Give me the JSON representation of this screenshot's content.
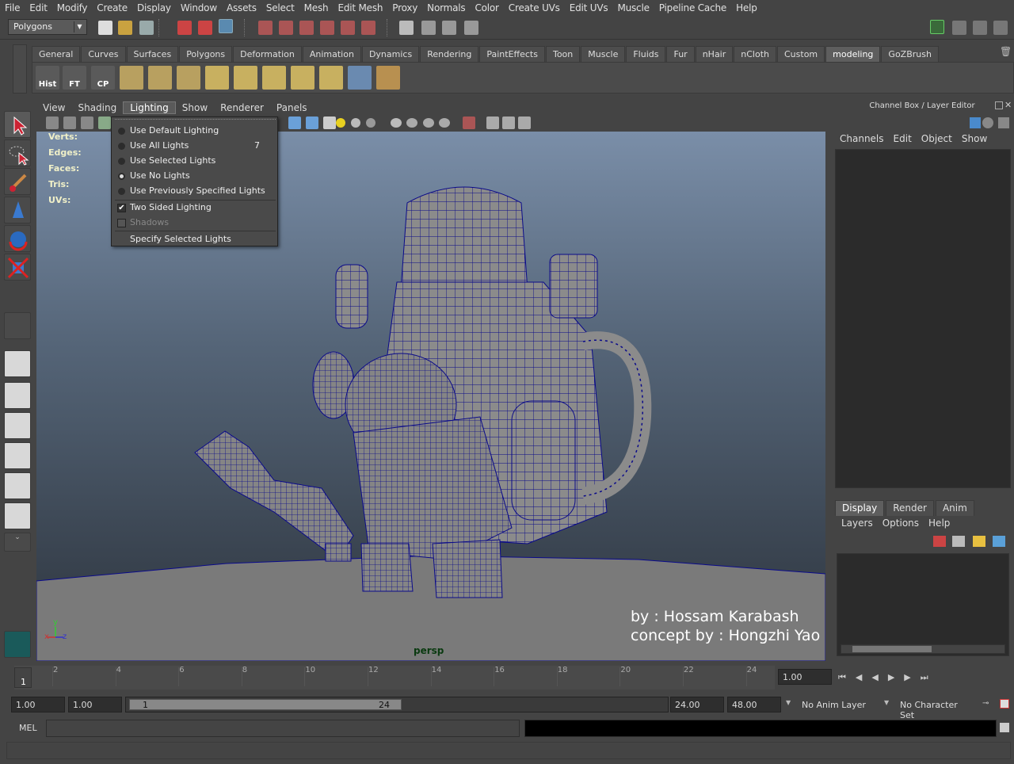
{
  "menubar": [
    "File",
    "Edit",
    "Modify",
    "Create",
    "Display",
    "Window",
    "Assets",
    "Select",
    "Mesh",
    "Edit Mesh",
    "Proxy",
    "Normals",
    "Color",
    "Create UVs",
    "Edit UVs",
    "Muscle",
    "Pipeline Cache",
    "Help"
  ],
  "status": {
    "mode": "Polygons"
  },
  "shelf": {
    "tabs": [
      "General",
      "Curves",
      "Surfaces",
      "Polygons",
      "Deformation",
      "Animation",
      "Dynamics",
      "Rendering",
      "PaintEffects",
      "Toon",
      "Muscle",
      "Fluids",
      "Fur",
      "nHair",
      "nCloth",
      "Custom",
      "modeling",
      "GoZBrush"
    ],
    "active_tab": "modeling",
    "buttons": [
      "Hist",
      "FT",
      "CP"
    ]
  },
  "panel": {
    "menu": [
      "View",
      "Shading",
      "Lighting",
      "Show",
      "Renderer",
      "Panels"
    ],
    "active_menu": "Lighting",
    "hud_labels": [
      "Verts:",
      "Edges:",
      "Faces:",
      "Tris:",
      "UVs:"
    ],
    "camera": "persp",
    "credit_line1": "by : Hossam Karabash",
    "credit_line2": "concept by : Hongzhi Yao",
    "axis_y": "y",
    "axis_x": "x",
    "axis_z": "z"
  },
  "lighting_menu": {
    "items": [
      {
        "label": "Use Default Lighting",
        "type": "radio",
        "selected": false,
        "shortcut": ""
      },
      {
        "label": "Use All Lights",
        "type": "radio",
        "selected": false,
        "shortcut": "7"
      },
      {
        "label": "Use Selected Lights",
        "type": "radio",
        "selected": false,
        "shortcut": ""
      },
      {
        "label": "Use No Lights",
        "type": "radio",
        "selected": true,
        "shortcut": ""
      },
      {
        "label": "Use Previously Specified Lights",
        "type": "radio",
        "selected": false,
        "shortcut": ""
      },
      {
        "label": "Two Sided Lighting",
        "type": "check",
        "checked": true
      },
      {
        "label": "Shadows",
        "type": "check",
        "checked": false,
        "disabled": true
      },
      {
        "label": "Specify Selected Lights",
        "type": "action"
      }
    ]
  },
  "channel_box": {
    "title": "Channel Box / Layer Editor",
    "menu": [
      "Channels",
      "Edit",
      "Object",
      "Show"
    ],
    "layer_tabs": [
      "Display",
      "Render",
      "Anim"
    ],
    "active_layer_tab": "Display",
    "layer_menu": [
      "Layers",
      "Options",
      "Help"
    ]
  },
  "timeslider": {
    "current_frame": "1",
    "ticks": [
      "2",
      "4",
      "6",
      "8",
      "10",
      "12",
      "14",
      "16",
      "18",
      "20",
      "22",
      "24"
    ],
    "current_time": "1.00"
  },
  "range": {
    "start": "1.00",
    "playback_start": "1.00",
    "range_start": "1",
    "range_end": "24",
    "playback_end": "24.00",
    "end": "48.00",
    "anim_layer": "No Anim Layer",
    "character_set": "No Character Set"
  },
  "cmd": {
    "label": "MEL"
  },
  "colors": {
    "accent": "#5285a6",
    "wire": "#0a0a8a",
    "mesh": "#8b8b8b"
  }
}
